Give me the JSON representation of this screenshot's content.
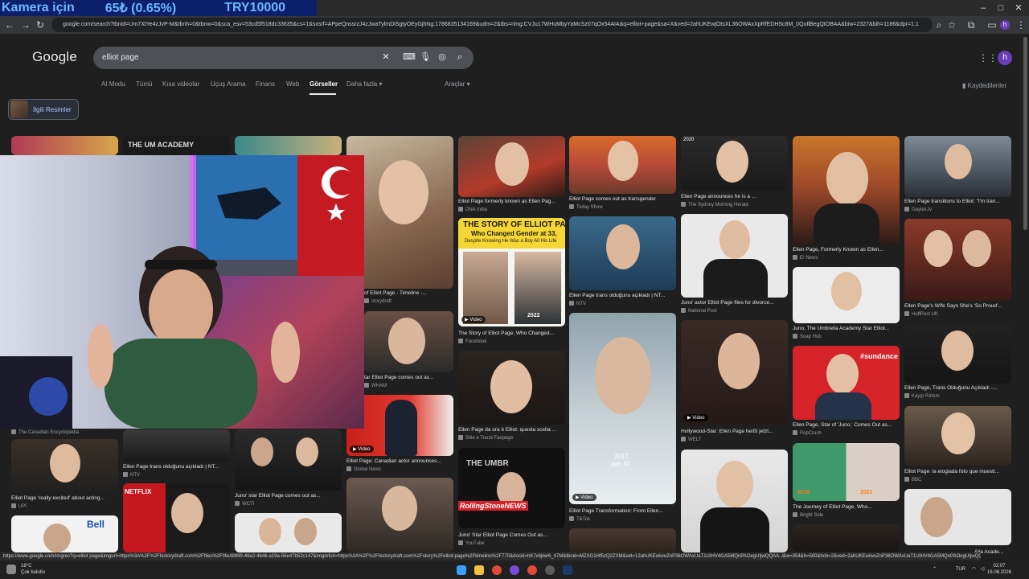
{
  "overlay": {
    "label": "Kamera için",
    "price": "65₺ (0.65%)",
    "goal": "TRY10000"
  },
  "window_controls": {
    "minimize": "–",
    "maximize": "□",
    "close": "✕"
  },
  "browser": {
    "url": "google.com/search?tbnid=Um7XtYe4zJvP-M&tbnh=0&tbnw=0&sca_esv=53cd5f518dc33635&cs=1&sxsrf=APpeQnssrzJ4zJwaTylmDiSgtyOEyGjhNg:1786835134169&udm=2&tbs=rimg:CVJu17WHuMbyYaMcSz07qOx54AIA&q=elliot+page&sa=X&ved=2ahUKEwjOtsXL36OWAxXpRfEDHSc8M_0QuIlBegQIOBAA&biw=2327&bih=1186&dpr=1.1",
    "status_url": "https://www.google.com/imgres?q=elliot page&imgurl=https%3A%2F%2Fhistorydraft.com%2Ffiles%2Ff4e48999-46e2-4b46-a19a-56e47b52c147&imgrefurl=https%3A%2F%2Fhistorydraft.com%2Fstory%2Felliot-page%2Ftimeline%2F770&docid=hK7xbjlwr6_47M&tbnid=MZXG1Hf5zQ2ZXM&vet=12ahUKEwiwoZnP36OWAxUaT1UIHV4GA5MQnPAOegUIjwQQAA..i&w=354&h=500&hcb=2&ved=2ahUKEwiwoZnP36OWAxUaT1UIHV4GA5MQnPAOegUIjwQQAA"
  },
  "google": {
    "logo": "Google",
    "query": "elliot page",
    "avatar_letter": "h",
    "tabs": [
      "AI Modu",
      "Tümü",
      "Kısa videolar",
      "Uçuş Arama",
      "Finans",
      "Web",
      "Görseller",
      "Daha fazla ▾"
    ],
    "tools": "Araçlar ▾",
    "saved": "Kaydedilenler",
    "related": "İlgili Resimler"
  },
  "results": [
    {
      "caption": "Elliot Page formerly known as Ellen Pag...",
      "source": "DNA India"
    },
    {
      "caption": "Elliot Page comes out as transgender",
      "source": "Today Show"
    },
    {
      "caption": "Ellen Page announces he is a ...",
      "source": "The Sydney Morning Herald"
    },
    {
      "caption": "Ellen Page transitions to Elliot: \"I'm tran...",
      "source": "Gayles.tv"
    },
    {
      "caption": "Ellen Page, Formerly Known as Ellen...",
      "source": "E! News"
    },
    {
      "caption": "The Story of Elliot Page, Who Changed...",
      "source": "Facebook"
    },
    {
      "caption": "Ellen Page trans olduğunu açıkladı | NT...",
      "source": "NTV"
    },
    {
      "caption": "Juno' actor Elliot Page files for divorce...",
      "source": "National Post"
    },
    {
      "caption": "Juno, The Umbrella Academy Star Elliot...",
      "source": "Soap Hub"
    },
    {
      "caption": "Ellen Page's Wife Says She's 'So Proud'...",
      "source": "HuffPost UK"
    },
    {
      "caption": "of Elliot Page - Timeline -...",
      "source": "storydraft"
    },
    {
      "caption": "tar Elliot Page comes out as...",
      "source": "WHAM"
    },
    {
      "caption": "Ellen Page da ora è Elliot: questa scelta ...",
      "source": "Stile e Trend Fanpage"
    },
    {
      "caption": "Hollywood-Star: Ellen Page heißt jetzt...",
      "source": "WELT"
    },
    {
      "caption": "Ellen Page, Star of 'Juno,' Comes Out as...",
      "source": "PopCrush"
    },
    {
      "caption": "Ellen Page, Trans Olduğunu Açıkladı -...",
      "source": "Kayıp Rıhtım"
    },
    {
      "caption": "Elliot Page 'really excited' about acting...",
      "source": "UPI"
    },
    {
      "caption": "Ellen Page trans olduğunu açıkladı | NT...",
      "source": "NTV"
    },
    {
      "caption": "Juno' star Elliot Page comes out as...",
      "source": "WCTI"
    },
    {
      "caption": "Elliot Page: Canadian actor announces...",
      "source": "Global News"
    },
    {
      "caption": "Juno' Star Elliot Page Comes Out as...",
      "source": "YouTube"
    },
    {
      "caption": "Elliot Page Transformation: From Ellen...",
      "source": "TikTok"
    },
    {
      "caption": "The Journey of Elliot Page, Who...",
      "source": "Bright Side"
    },
    {
      "caption": "Elliot Page: la elogiada foto que muestr...",
      "source": "BBC"
    },
    {
      "caption": "Alia Acade...",
      "source": ""
    },
    {
      "caption": "The Canadian Encyclopedia",
      "source": ""
    }
  ],
  "image_text": {
    "story_title": "THE STORY OF ELLIOT PAGE,",
    "story_sub": "Who Changed Gender at 33,",
    "story_sub2": "Despite Knowing He Was a Boy All His Life",
    "year_2022": "2022",
    "year_2020": "2020",
    "year_2017": "2017",
    "age_30": "age: 30",
    "year_2010": "2010",
    "year_2021": "2021",
    "rolling": "RollingStoneNEWS",
    "umbrella": "THE UMBR",
    "video": "▶ Video",
    "sundance": "#sundance",
    "netflix": "NETFLIX",
    "academy": "THE UM   ACADEMY",
    "bell": "Bell"
  },
  "taskbar": {
    "temp": "18°C",
    "weather": "Çok bulutlu",
    "lang": "TUR",
    "time": "02:07",
    "date": "16.08.2026"
  }
}
